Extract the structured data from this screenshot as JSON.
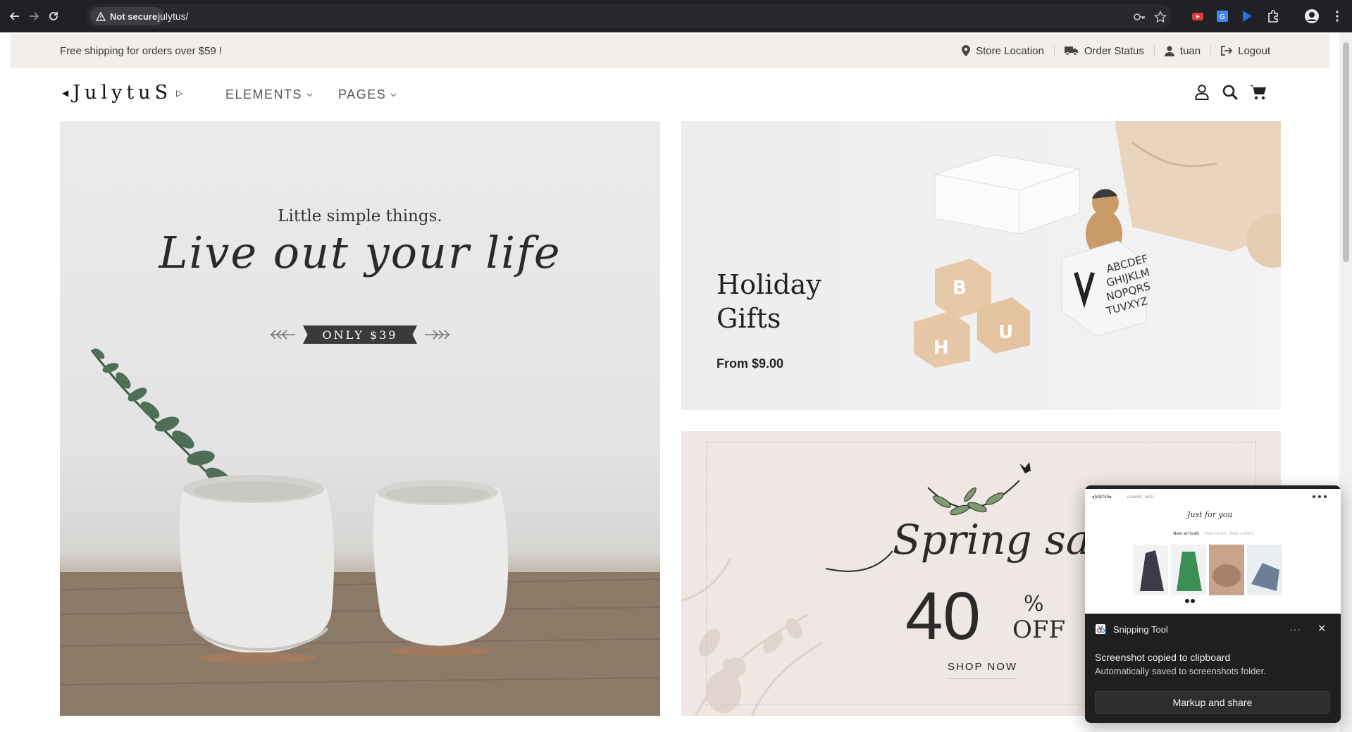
{
  "browser": {
    "security_label": "Not secure",
    "url": "julytus/"
  },
  "topbar": {
    "shipping_text": "Free shipping for orders over $59 !",
    "links": [
      {
        "label": "Store Location",
        "icon": "map-pin-icon"
      },
      {
        "label": "Order Status",
        "icon": "truck-icon"
      },
      {
        "label": "tuan",
        "icon": "user-icon"
      },
      {
        "label": "Logout",
        "icon": "logout-icon"
      }
    ]
  },
  "header": {
    "logo": "JulytuS",
    "menu": [
      {
        "label": "ELEMENTS"
      },
      {
        "label": "PAGES"
      }
    ]
  },
  "banner_main": {
    "tagline": "Little simple things.",
    "headline": "Live out your life",
    "ribbon": "ONLY $39"
  },
  "banner_holiday": {
    "title_line1": "Holiday",
    "title_line2": "Gifts",
    "price": "From $9.00"
  },
  "banner_sale": {
    "script": "Spring sale",
    "number": "40",
    "percent": "%",
    "off": "OFF",
    "cta": "SHOP NOW"
  },
  "toast": {
    "app_name": "Snipping Tool",
    "title": "Screenshot copied to clipboard",
    "subtitle": "Automatically saved to screenshots folder.",
    "button": "Markup and share",
    "more": "···",
    "close": "✕",
    "thumb_heading": "Just for you",
    "thumb_tabs": [
      "New arrivals",
      "Sale items",
      "Best sellers"
    ]
  },
  "colors": {
    "topbar_bg": "#f4eeea",
    "sale_bg": "#efe7e3",
    "chrome_bg": "#202124"
  }
}
